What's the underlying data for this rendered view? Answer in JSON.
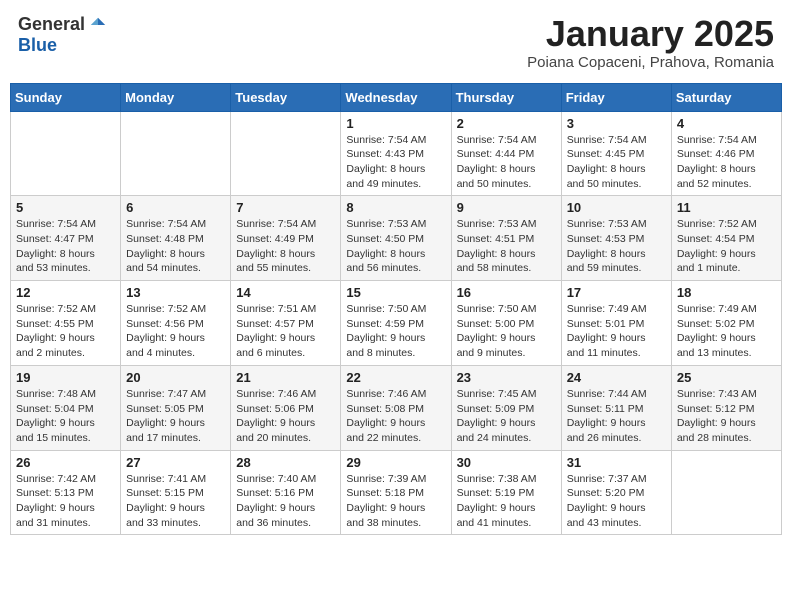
{
  "logo": {
    "general": "General",
    "blue": "Blue"
  },
  "title": "January 2025",
  "location": "Poiana Copaceni, Prahova, Romania",
  "days_of_week": [
    "Sunday",
    "Monday",
    "Tuesday",
    "Wednesday",
    "Thursday",
    "Friday",
    "Saturday"
  ],
  "weeks": [
    [
      {
        "day": "",
        "info": ""
      },
      {
        "day": "",
        "info": ""
      },
      {
        "day": "",
        "info": ""
      },
      {
        "day": "1",
        "info": "Sunrise: 7:54 AM\nSunset: 4:43 PM\nDaylight: 8 hours\nand 49 minutes."
      },
      {
        "day": "2",
        "info": "Sunrise: 7:54 AM\nSunset: 4:44 PM\nDaylight: 8 hours\nand 50 minutes."
      },
      {
        "day": "3",
        "info": "Sunrise: 7:54 AM\nSunset: 4:45 PM\nDaylight: 8 hours\nand 50 minutes."
      },
      {
        "day": "4",
        "info": "Sunrise: 7:54 AM\nSunset: 4:46 PM\nDaylight: 8 hours\nand 52 minutes."
      }
    ],
    [
      {
        "day": "5",
        "info": "Sunrise: 7:54 AM\nSunset: 4:47 PM\nDaylight: 8 hours\nand 53 minutes."
      },
      {
        "day": "6",
        "info": "Sunrise: 7:54 AM\nSunset: 4:48 PM\nDaylight: 8 hours\nand 54 minutes."
      },
      {
        "day": "7",
        "info": "Sunrise: 7:54 AM\nSunset: 4:49 PM\nDaylight: 8 hours\nand 55 minutes."
      },
      {
        "day": "8",
        "info": "Sunrise: 7:53 AM\nSunset: 4:50 PM\nDaylight: 8 hours\nand 56 minutes."
      },
      {
        "day": "9",
        "info": "Sunrise: 7:53 AM\nSunset: 4:51 PM\nDaylight: 8 hours\nand 58 minutes."
      },
      {
        "day": "10",
        "info": "Sunrise: 7:53 AM\nSunset: 4:53 PM\nDaylight: 8 hours\nand 59 minutes."
      },
      {
        "day": "11",
        "info": "Sunrise: 7:52 AM\nSunset: 4:54 PM\nDaylight: 9 hours\nand 1 minute."
      }
    ],
    [
      {
        "day": "12",
        "info": "Sunrise: 7:52 AM\nSunset: 4:55 PM\nDaylight: 9 hours\nand 2 minutes."
      },
      {
        "day": "13",
        "info": "Sunrise: 7:52 AM\nSunset: 4:56 PM\nDaylight: 9 hours\nand 4 minutes."
      },
      {
        "day": "14",
        "info": "Sunrise: 7:51 AM\nSunset: 4:57 PM\nDaylight: 9 hours\nand 6 minutes."
      },
      {
        "day": "15",
        "info": "Sunrise: 7:50 AM\nSunset: 4:59 PM\nDaylight: 9 hours\nand 8 minutes."
      },
      {
        "day": "16",
        "info": "Sunrise: 7:50 AM\nSunset: 5:00 PM\nDaylight: 9 hours\nand 9 minutes."
      },
      {
        "day": "17",
        "info": "Sunrise: 7:49 AM\nSunset: 5:01 PM\nDaylight: 9 hours\nand 11 minutes."
      },
      {
        "day": "18",
        "info": "Sunrise: 7:49 AM\nSunset: 5:02 PM\nDaylight: 9 hours\nand 13 minutes."
      }
    ],
    [
      {
        "day": "19",
        "info": "Sunrise: 7:48 AM\nSunset: 5:04 PM\nDaylight: 9 hours\nand 15 minutes."
      },
      {
        "day": "20",
        "info": "Sunrise: 7:47 AM\nSunset: 5:05 PM\nDaylight: 9 hours\nand 17 minutes."
      },
      {
        "day": "21",
        "info": "Sunrise: 7:46 AM\nSunset: 5:06 PM\nDaylight: 9 hours\nand 20 minutes."
      },
      {
        "day": "22",
        "info": "Sunrise: 7:46 AM\nSunset: 5:08 PM\nDaylight: 9 hours\nand 22 minutes."
      },
      {
        "day": "23",
        "info": "Sunrise: 7:45 AM\nSunset: 5:09 PM\nDaylight: 9 hours\nand 24 minutes."
      },
      {
        "day": "24",
        "info": "Sunrise: 7:44 AM\nSunset: 5:11 PM\nDaylight: 9 hours\nand 26 minutes."
      },
      {
        "day": "25",
        "info": "Sunrise: 7:43 AM\nSunset: 5:12 PM\nDaylight: 9 hours\nand 28 minutes."
      }
    ],
    [
      {
        "day": "26",
        "info": "Sunrise: 7:42 AM\nSunset: 5:13 PM\nDaylight: 9 hours\nand 31 minutes."
      },
      {
        "day": "27",
        "info": "Sunrise: 7:41 AM\nSunset: 5:15 PM\nDaylight: 9 hours\nand 33 minutes."
      },
      {
        "day": "28",
        "info": "Sunrise: 7:40 AM\nSunset: 5:16 PM\nDaylight: 9 hours\nand 36 minutes."
      },
      {
        "day": "29",
        "info": "Sunrise: 7:39 AM\nSunset: 5:18 PM\nDaylight: 9 hours\nand 38 minutes."
      },
      {
        "day": "30",
        "info": "Sunrise: 7:38 AM\nSunset: 5:19 PM\nDaylight: 9 hours\nand 41 minutes."
      },
      {
        "day": "31",
        "info": "Sunrise: 7:37 AM\nSunset: 5:20 PM\nDaylight: 9 hours\nand 43 minutes."
      },
      {
        "day": "",
        "info": ""
      }
    ]
  ]
}
